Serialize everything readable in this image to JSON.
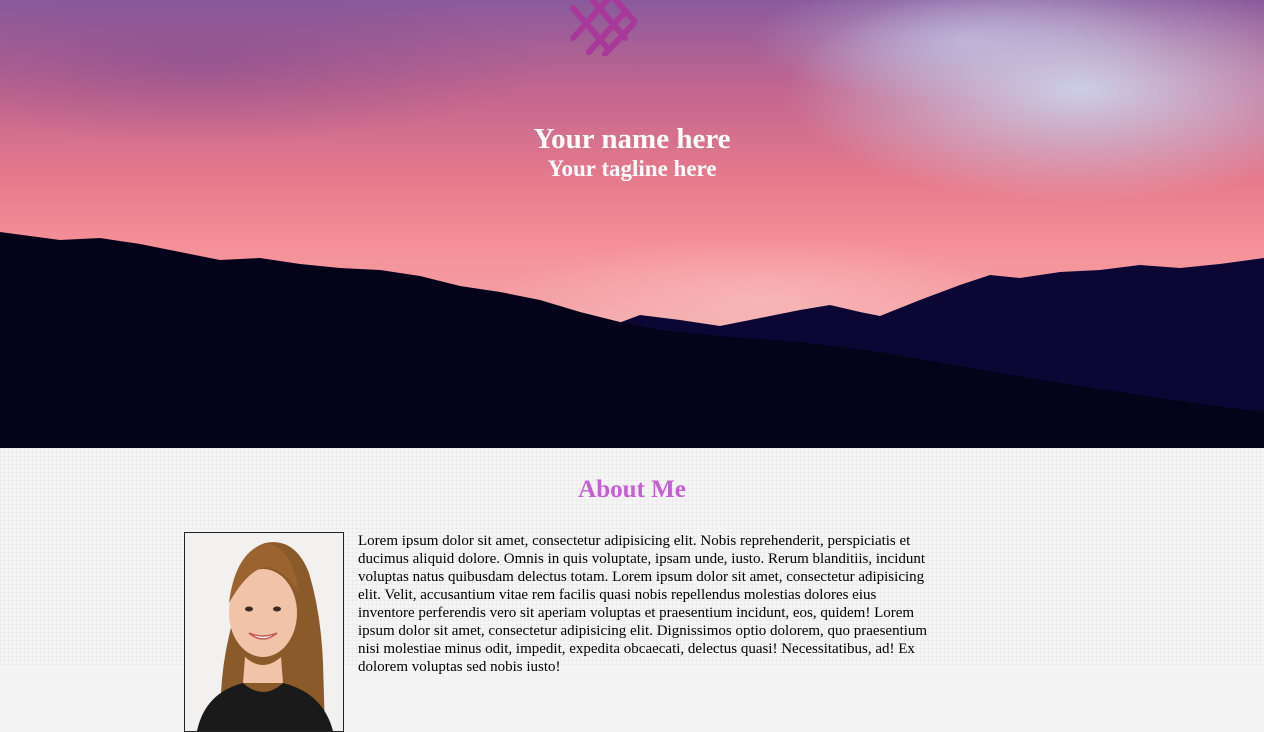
{
  "hero": {
    "name": "Your name here",
    "tagline": "Your tagline here",
    "logo_icon": "crosshatch-logo-icon",
    "logo_color": "#a8399a"
  },
  "about": {
    "title": "About Me",
    "title_color": "#c55fd6",
    "photo_icon": "profile-photo",
    "body": "Lorem ipsum dolor sit amet, consectetur adipisicing elit. Nobis reprehenderit, perspiciatis et ducimus aliquid dolore. Omnis in quis voluptate, ipsam unde, iusto. Rerum blanditiis, incidunt voluptas natus quibusdam delectus totam. Lorem ipsum dolor sit amet, consectetur adipisicing elit. Velit, accusantium vitae rem facilis quasi nobis repellendus molestias dolores eius inventore perferendis vero sit aperiam voluptas et praesentium incidunt, eos, quidem! Lorem ipsum dolor sit amet, consectetur adipisicing elit. Dignissimos optio dolorem, quo praesentium nisi molestiae minus odit, impedit, expedita obcaecati, delectus quasi! Necessitatibus, ad! Ex dolorem voluptas sed nobis iusto!"
  }
}
